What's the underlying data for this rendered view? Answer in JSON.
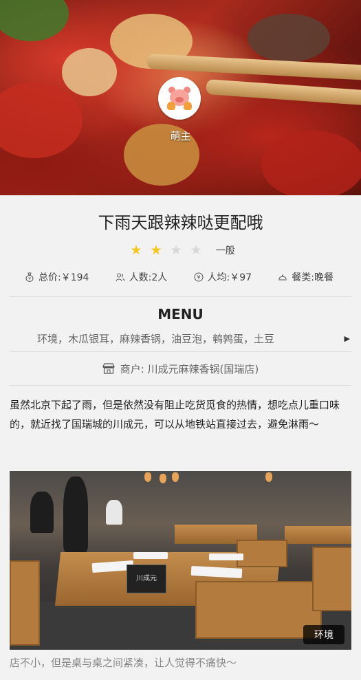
{
  "hero": {
    "username": "萌主",
    "avatar_icon": "pig-avatar-icon"
  },
  "post": {
    "title": "下雨天跟辣辣哒更配哦",
    "rating": {
      "value": 2,
      "max": 5,
      "label": "一般"
    },
    "stats": {
      "total_price": "总价:￥194",
      "people": "人数:2人",
      "per_person": "人均:￥97",
      "meal": "餐类:晚餐"
    },
    "menu": {
      "heading": "MENU",
      "items": "环境，木瓜银耳，麻辣香锅，油豆泡，鹌鹑蛋，土豆"
    },
    "merchant": "商户: 川成元麻辣香锅(国瑞店)",
    "description": "虽然北京下起了雨，但是依然没有阻止吃货觅食的热情，想吃点儿重口味的，就近找了国瑞城的川成元，可以从地铁站直接过去，避免淋雨～",
    "photo": {
      "tag": "环境",
      "sign_text": "川成元"
    },
    "caption": "店不小，但是桌与桌之间紧凑，让人觉得不痛快～"
  },
  "colors": {
    "star_on": "#f5c518",
    "star_off": "#d7d7d7",
    "background": "#f2f2f2"
  }
}
